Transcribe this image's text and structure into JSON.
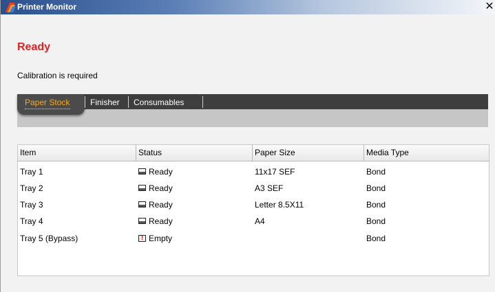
{
  "window": {
    "title": "Printer Monitor",
    "close_glyph": "✕"
  },
  "status": {
    "title": "Ready",
    "message": "Calibration is required"
  },
  "colors": {
    "status_red": "#e5211f",
    "tab_active_text": "#f7a81b",
    "tabbar_dark": "#3e3e3e"
  },
  "tabs": [
    {
      "label": "Paper Stock",
      "active": true
    },
    {
      "label": "Finisher",
      "active": false
    },
    {
      "label": "Consumables",
      "active": false
    }
  ],
  "table": {
    "columns": [
      "Item",
      "Status",
      "Paper Size",
      "Media Type"
    ],
    "rows": [
      {
        "item": "Tray 1",
        "status": "Ready",
        "status_icon": "tray-ready-icon",
        "paper_size": "11x17 SEF",
        "media_type": "Bond"
      },
      {
        "item": "Tray 2",
        "status": "Ready",
        "status_icon": "tray-ready-icon",
        "paper_size": "A3 SEF",
        "media_type": "Bond"
      },
      {
        "item": "Tray 3",
        "status": "Ready",
        "status_icon": "tray-ready-icon",
        "paper_size": "Letter 8.5X11",
        "media_type": "Bond"
      },
      {
        "item": "Tray 4",
        "status": "Ready",
        "status_icon": "tray-ready-icon",
        "paper_size": "A4",
        "media_type": "Bond"
      },
      {
        "item": "Tray 5 (Bypass)",
        "status": "Empty",
        "status_icon": "tray-empty-icon",
        "paper_size": "",
        "media_type": "Bond"
      }
    ]
  }
}
